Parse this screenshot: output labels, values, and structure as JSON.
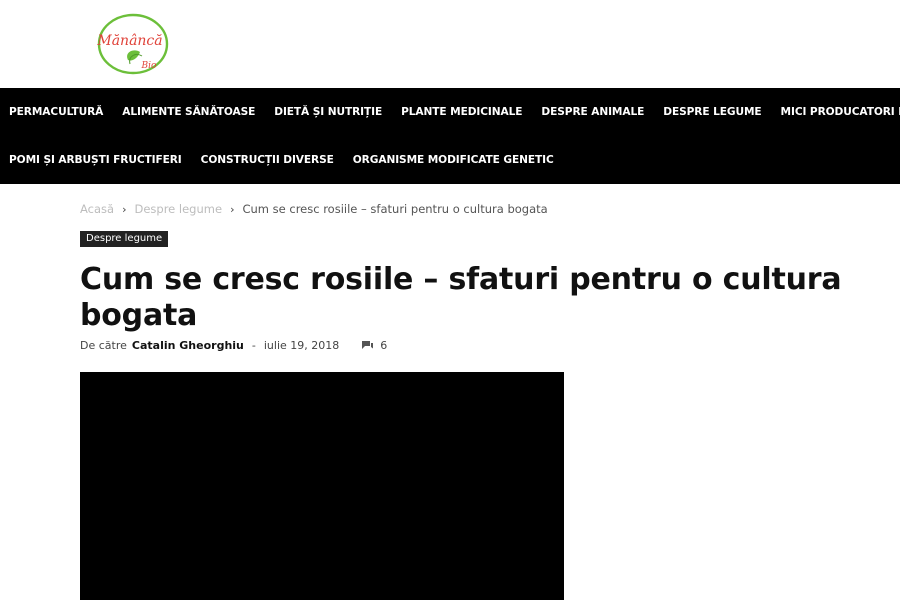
{
  "logo": {
    "text_line1": "Mănâncă",
    "text_line2": "Bio",
    "accent_green": "#6cbf3a",
    "accent_red": "#e0433a"
  },
  "nav": {
    "row1": [
      "PERMACULTURĂ",
      "ALIMENTE SĂNĂTOASE",
      "DIETĂ ȘI NUTRIȚIE",
      "PLANTE MEDICINALE",
      "DESPRE ANIMALE",
      "DESPRE LEGUME",
      "MICI PRODUCATORI BIO"
    ],
    "row2": [
      "POMI ȘI ARBUȘTI FRUCTIFERI",
      "CONSTRUCȚII DIVERSE",
      "ORGANISME MODIFICATE GENETIC"
    ],
    "background": "#000000"
  },
  "breadcrumb": {
    "home": "Acasă",
    "separator": "›",
    "category": "Despre legume",
    "current": "Cum se cresc rosiile – sfaturi pentru o cultura bogata"
  },
  "article": {
    "category_tag": "Despre legume",
    "title": "Cum se cresc rosiile – sfaturi pentru o cultura bogata",
    "by_label": "De către",
    "author": "Catalin Gheorghiu",
    "dash": "-",
    "date": "iulie 19, 2018",
    "comments_count": "6",
    "comments_icon": "comment-bubble-icon"
  }
}
